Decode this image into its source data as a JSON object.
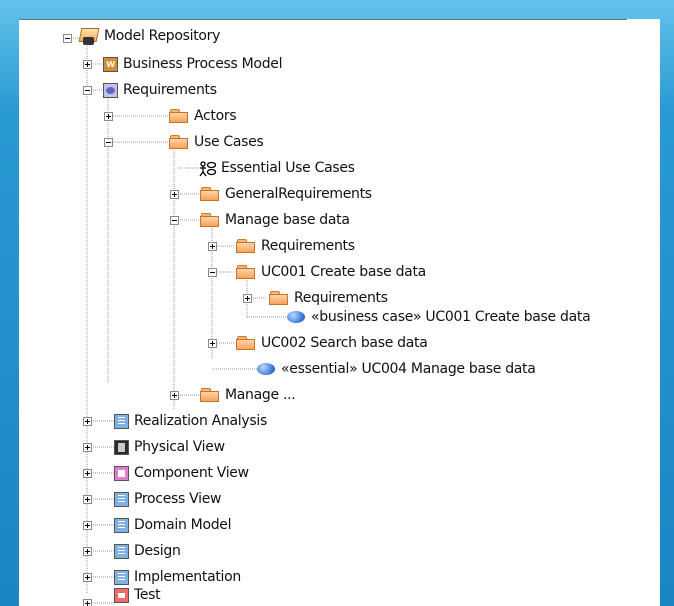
{
  "tree": {
    "root": {
      "label": "Model Repository",
      "icon": "repository-icon"
    },
    "items": [
      {
        "label": "Business Process Model",
        "icon": "package-bpm-icon",
        "bpm_glyph": "W",
        "state": "collapsed"
      },
      {
        "label": "Requirements",
        "icon": "package-requirements-icon",
        "state": "expanded"
      },
      {
        "label": "Actors",
        "icon": "folder-icon",
        "state": "collapsed"
      },
      {
        "label": "Use Cases",
        "icon": "folder-icon",
        "state": "expanded"
      },
      {
        "label": "Essential Use Cases",
        "icon": "actor-usecase-icon"
      },
      {
        "label": "GeneralRequirements",
        "icon": "folder-icon",
        "state": "collapsed"
      },
      {
        "label": "Manage base data",
        "icon": "folder-icon",
        "state": "expanded"
      },
      {
        "label": "Requirements",
        "icon": "folder-icon",
        "state": "collapsed"
      },
      {
        "label": "UC001 Create base data",
        "icon": "folder-icon",
        "state": "expanded"
      },
      {
        "label": "Requirements",
        "icon": "folder-icon",
        "state": "collapsed"
      },
      {
        "label": "«business case» UC001 Create base data",
        "icon": "use-case-icon"
      },
      {
        "label": "UC002 Search base data",
        "icon": "folder-icon",
        "state": "collapsed"
      },
      {
        "label": "«essential» UC004 Manage base data",
        "icon": "use-case-icon"
      },
      {
        "label": "Manage ...",
        "icon": "folder-icon",
        "state": "collapsed"
      },
      {
        "label": "Realization Analysis",
        "icon": "package-blue-icon",
        "state": "collapsed"
      },
      {
        "label": "Physical View",
        "icon": "package-dark-icon",
        "state": "collapsed"
      },
      {
        "label": "Component View",
        "icon": "package-pink-icon",
        "state": "collapsed"
      },
      {
        "label": "Process View",
        "icon": "package-blue-icon",
        "state": "collapsed"
      },
      {
        "label": "Domain Model",
        "icon": "package-blue-icon",
        "state": "collapsed"
      },
      {
        "label": "Design",
        "icon": "package-blue-icon",
        "state": "collapsed"
      },
      {
        "label": "Implementation",
        "icon": "package-blue-icon",
        "state": "collapsed"
      },
      {
        "label": "Test",
        "icon": "package-red-icon",
        "state": "collapsed"
      }
    ]
  },
  "colors": {
    "frame_blue": "#1a86c4",
    "folder_orange": "#f7a45a",
    "use_case_blue": "#3d78d8"
  }
}
